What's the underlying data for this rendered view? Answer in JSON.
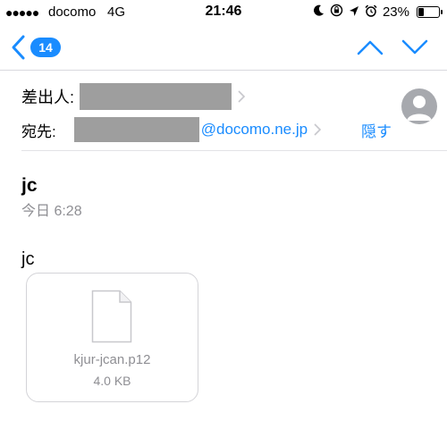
{
  "status_bar": {
    "signal": "●●●●●",
    "carrier": "docomo",
    "network": "4G",
    "time": "21:46",
    "icons": [
      "moon-icon",
      "rotation-lock-icon",
      "location-arrow-icon",
      "alarm-clock-icon"
    ],
    "battery_percent_text": "23%",
    "battery_level": 0.23
  },
  "nav": {
    "back_badge": "14"
  },
  "header": {
    "from_label": "差出人:",
    "to_label": "宛先:",
    "to_domain": "@docomo.ne.jp",
    "hide_label": "隠す"
  },
  "message": {
    "subject": "jc",
    "date": "今日 6:28",
    "body": "jc"
  },
  "attachment": {
    "file_name": "kjur-jcan.p12",
    "file_size": "4.0 KB"
  },
  "colors": {
    "accent": "#1a8cff",
    "secondary_text": "#8e8e93",
    "redaction": "#9e9e9e"
  }
}
